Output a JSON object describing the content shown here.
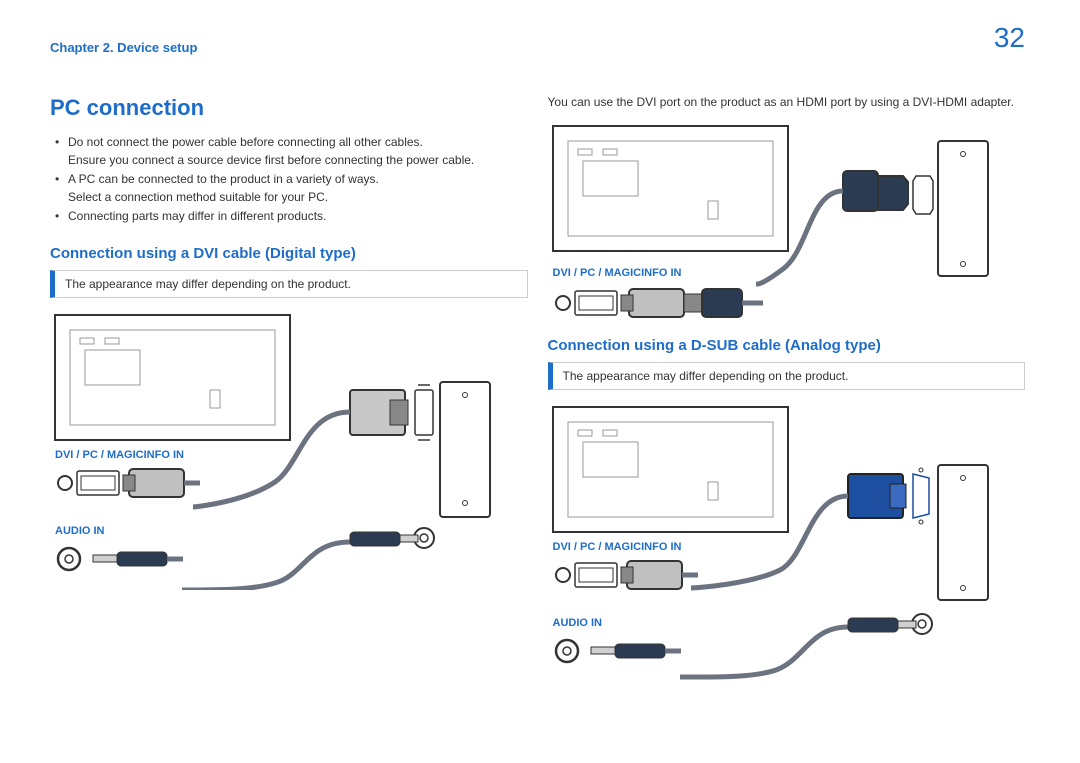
{
  "header": {
    "chapter": "Chapter 2. Device setup",
    "page_number": "32"
  },
  "left": {
    "main_heading": "PC connection",
    "bullets": {
      "b1": "Do not connect the power cable before connecting all other cables.",
      "b1_sub": "Ensure you connect a source device first before connecting the power cable.",
      "b2": "A PC can be connected to the product in a variety of ways.",
      "b2_sub": "Select a connection method suitable for your PC.",
      "b3": "Connecting parts may differ in different products."
    },
    "section1": {
      "heading": "Connection using a DVI cable (Digital type)",
      "note": "The appearance may differ depending on the product.",
      "port_dvi": "DVI / PC / MAGICINFO IN",
      "port_audio": "AUDIO IN"
    }
  },
  "right": {
    "intro": "You can use the DVI port on the product as an HDMI port by using a DVI-HDMI adapter.",
    "port_dvi": "DVI / PC / MAGICINFO IN",
    "section2": {
      "heading": "Connection using a D-SUB cable (Analog type)",
      "note": "The appearance may differ depending on the product.",
      "port_dvi": "DVI / PC / MAGICINFO IN",
      "port_audio": "AUDIO IN"
    }
  }
}
